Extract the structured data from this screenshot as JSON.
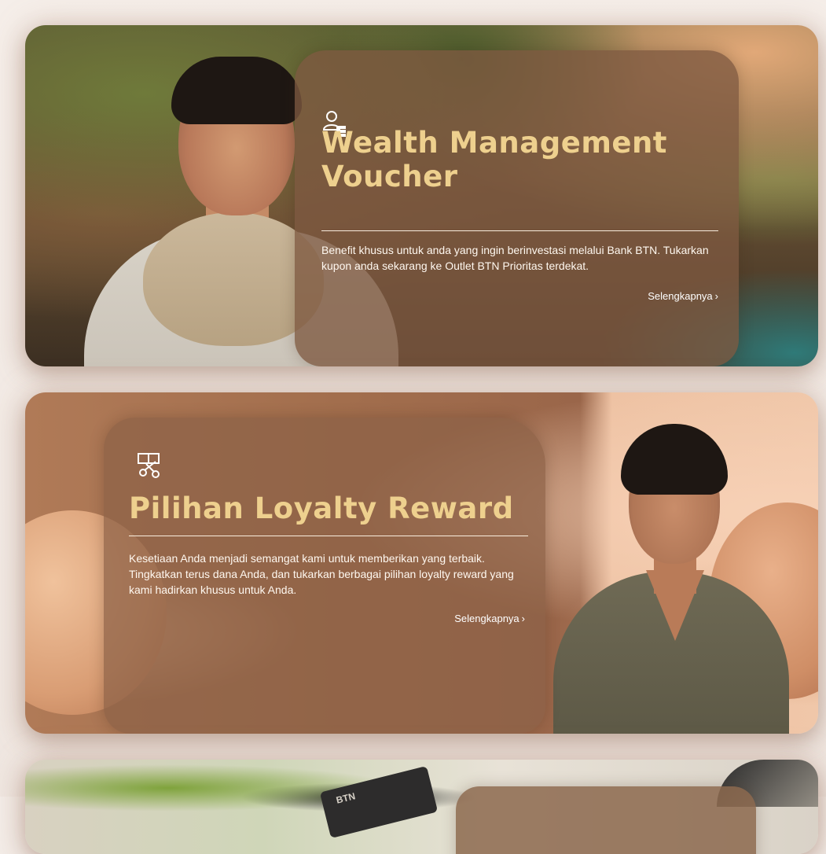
{
  "cards": [
    {
      "icon": "person-coins-icon",
      "title": "Wealth Management Voucher",
      "description": "Benefit khusus untuk anda yang ingin berinvestasi melalui Bank BTN. Tukarkan kupon anda sekarang ke Outlet BTN Prioritas terdekat.",
      "link_label": "Selengkapnya",
      "link_arrow": "›"
    },
    {
      "icon": "gift-scissors-icon",
      "title": "Pilihan Loyalty Reward",
      "description": "Kesetiaan Anda menjadi semangat kami untuk memberikan yang terbaik. Tingkatkan terus dana Anda, dan tukarkan berbagai pilihan loyalty reward yang kami hadirkan khusus untuk Anda.",
      "link_label": "Selengkapnya",
      "link_arrow": "›"
    },
    {
      "card_text": "BTN"
    }
  ],
  "colors": {
    "title_gold": "#eed08e",
    "panel_brown": "#7e5840",
    "page_bg": "#f3ece7"
  }
}
